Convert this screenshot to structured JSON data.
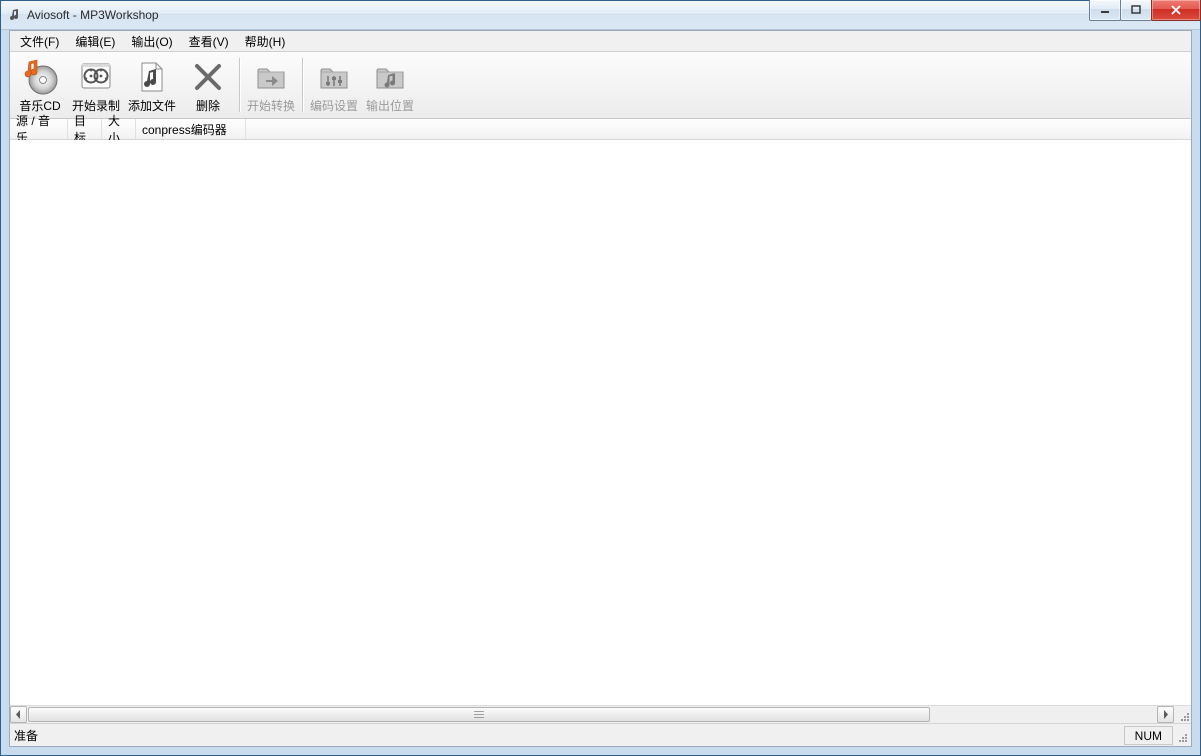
{
  "window": {
    "title": "Aviosoft - MP3Workshop"
  },
  "menu": {
    "file": "文件(F)",
    "edit": "编辑(E)",
    "output": "输出(O)",
    "view": "查看(V)",
    "help": "帮助(H)"
  },
  "toolbar": {
    "music_cd": "音乐CD",
    "start_record": "开始录制",
    "add_file": "添加文件",
    "delete": "删除",
    "start_convert": "开始转换",
    "encode_set": "编码设置",
    "output_loc": "输出位置"
  },
  "columns": {
    "source_music": "源 / 音乐",
    "target": "目标",
    "size": "大小",
    "encoder": "conpress编码器"
  },
  "status": {
    "ready": "准备",
    "num": "NUM"
  }
}
